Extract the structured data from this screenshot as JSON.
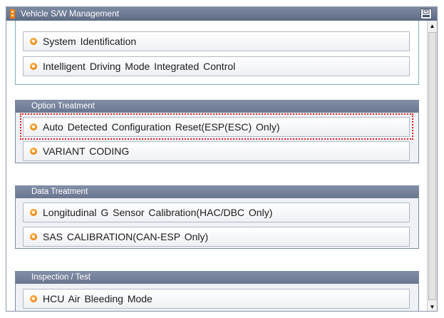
{
  "window": {
    "title": "Vehicle S/W Management",
    "close_icon": "exit-icon"
  },
  "top_group": {
    "items": [
      {
        "label": "System Identification"
      },
      {
        "label": "Intelligent Driving Mode Integrated Control"
      }
    ]
  },
  "option_treatment": {
    "title": "Option Treatment",
    "items": [
      {
        "label": "Auto Detected Configuration Reset(ESP(ESC) Only)",
        "highlighted": true
      },
      {
        "label": "VARIANT CODING"
      }
    ]
  },
  "data_treatment": {
    "title": "Data Treatment",
    "items": [
      {
        "label": "Longitudinal G Sensor Calibration(HAC/DBC Only)"
      },
      {
        "label": "SAS CALIBRATION(CAN-ESP Only)"
      }
    ]
  },
  "inspection_test": {
    "title": "Inspection / Test",
    "items": [
      {
        "label": "HCU Air Bleeding Mode"
      }
    ]
  },
  "colors": {
    "highlight_border": "#dd2222",
    "bullet": "#f08a10",
    "header": "#6a7690"
  }
}
